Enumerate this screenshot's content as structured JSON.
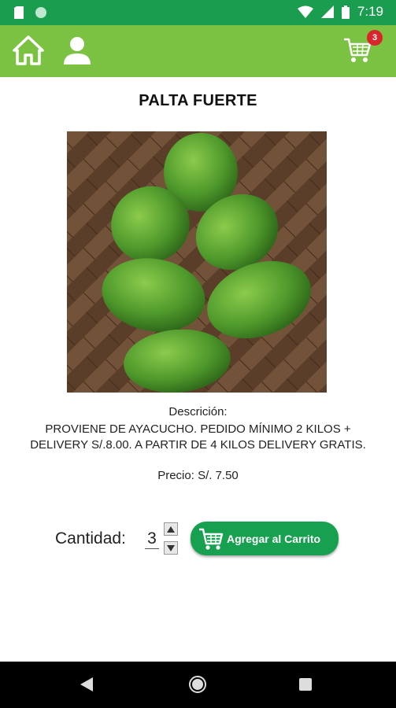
{
  "status_bar": {
    "time": "7:19",
    "icons": [
      "sim-card-icon",
      "notification-dot-icon",
      "wifi-icon",
      "signal-icon",
      "battery-icon"
    ]
  },
  "app_bar": {
    "icons": [
      "home-icon",
      "user-icon",
      "cart-icon"
    ],
    "cart_count": "3",
    "background_color": "#7cc242"
  },
  "product": {
    "title": "PALTA FUERTE",
    "description_label": "Descrición:",
    "description_line1": "PROVIENE DE AYACUCHO. PEDIDO MÍNIMO 2 KILOS +",
    "description_line2": "DELIVERY S/.8.00. A PARTIR DE 4 KILOS DELIVERY GRATIS.",
    "price": "Precio: S/. 7.50"
  },
  "quantity": {
    "label": "Cantidad:",
    "value": "3"
  },
  "add_button": {
    "label": "Agregar al Carrito",
    "color": "#17a050"
  },
  "nav_bar": {
    "icons": [
      "back-icon",
      "home-circle-icon",
      "recents-icon"
    ]
  }
}
